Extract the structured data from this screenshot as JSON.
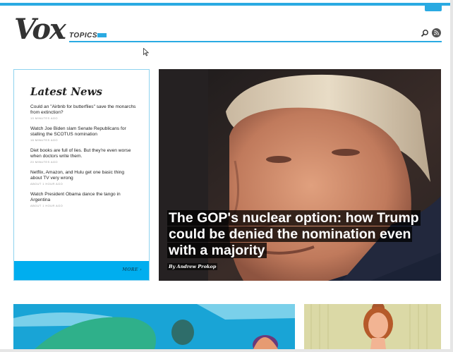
{
  "brand": {
    "logo": "Vox",
    "accent": "#2aaae2"
  },
  "header": {
    "topics_label": "TOPICS",
    "icons": [
      "search-icon",
      "rss-icon"
    ]
  },
  "latest_news": {
    "title": "Latest News",
    "items": [
      {
        "headline": "Could an \"Airbnb for butterflies\" save the monarchs from extinction?",
        "time": "10 MINUTES AGO"
      },
      {
        "headline": "Watch Joe Biden slam Senate Republicans for stalling the SCOTUS nomination",
        "time": "16 MINUTES AGO"
      },
      {
        "headline": "Diet books are full of lies. But they're even worse when doctors write them.",
        "time": "20 MINUTES AGO"
      },
      {
        "headline": "Netflix, Amazon, and Hulu get one basic thing about TV very wrong",
        "time": "ABOUT 1 HOUR AGO"
      },
      {
        "headline": "Watch President Obama dance the tango in Argentina",
        "time": "ABOUT 1 HOUR AGO"
      }
    ],
    "more_label": "MORE"
  },
  "hero": {
    "headline": "The GOP's nuclear option: how Trump could be denied the nomination even with a majority",
    "byline": "By Andrew Prokop"
  }
}
